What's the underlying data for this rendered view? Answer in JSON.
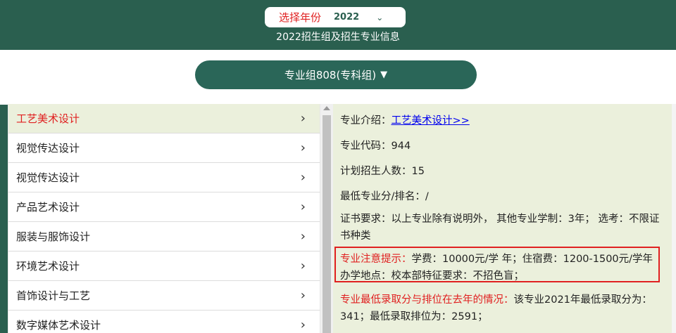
{
  "header": {
    "year_label": "选择年份",
    "year_value": "2022",
    "title": "2022招生组及招生专业信息"
  },
  "group_button": {
    "label": "专业组808(专科组)"
  },
  "majors": [
    "工艺美术设计",
    "视觉传达设计",
    "视觉传达设计",
    "产品艺术设计",
    "服装与服饰设计",
    "环境艺术设计",
    "首饰设计与工艺",
    "数字媒体艺术设计"
  ],
  "detail": {
    "intro_label": "专业介绍：",
    "intro_link": "工艺美术设计>>",
    "code_text": "专业代码：944",
    "plan_text": "计划招生人数：15",
    "min_score_text": "最低专业分/排名：/",
    "cert_text": "证书要求：以上专业除有说明外， 其他专业学制：3年； 选考：不限证书种类",
    "notice_label": "专业注意提示：",
    "notice_text": "学费：10000元/学 年；住宿费：1200-1500元/学年 办学地点：校本部特征要求：不招色盲；",
    "last_year_label": "专业最低录取分与排位在去年的情况：",
    "last_year_text": "该专业2021年最低录取分为：341；最低录取排位为：2591；"
  },
  "colors": {
    "header_bg": "#2a5f4f",
    "button_bg": "#2a6658",
    "accent_red": "#e02020",
    "panel_bg": "#ebf0dc"
  }
}
